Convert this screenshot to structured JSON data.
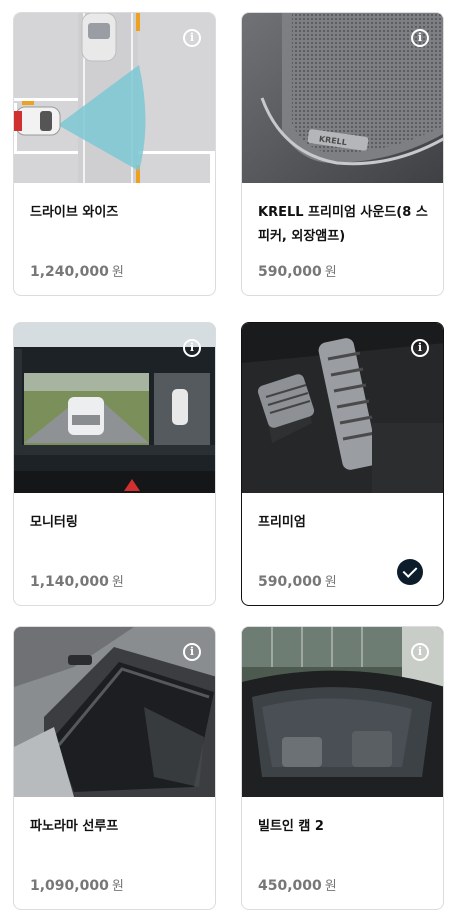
{
  "options": [
    {
      "name": "드라이브 와이즈",
      "price": "1,240,000",
      "currency": "원",
      "selected": false,
      "image": "drive-wise-sensor-illustration"
    },
    {
      "name": "KRELL 프리미엄 사운드(8 스피커, 외장앰프)",
      "price": "590,000",
      "currency": "원",
      "selected": false,
      "image": "krell-speaker-grille"
    },
    {
      "name": "모니터링",
      "price": "1,140,000",
      "currency": "원",
      "selected": false,
      "image": "surround-view-monitor"
    },
    {
      "name": "프리미엄",
      "price": "590,000",
      "currency": "원",
      "selected": true,
      "image": "sport-pedals"
    },
    {
      "name": "파노라마 선루프",
      "price": "1,090,000",
      "currency": "원",
      "selected": false,
      "image": "panoramic-sunroof"
    },
    {
      "name": "빌트인 캠 2",
      "price": "450,000",
      "currency": "원",
      "selected": false,
      "image": "built-in-cam"
    }
  ],
  "info_glyph": "i",
  "colors": {
    "check_bg": "#0d1c2b",
    "price_text": "#777777",
    "border": "#dcdcdc"
  }
}
